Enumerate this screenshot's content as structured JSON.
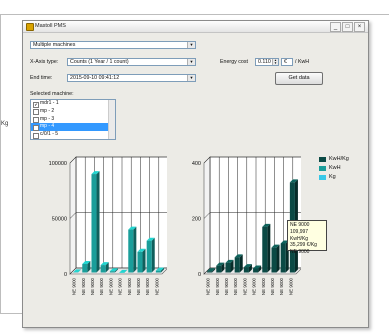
{
  "window": {
    "title": "Mastoll PMS",
    "controls": [
      "_",
      "□",
      "×"
    ]
  },
  "form": {
    "machine_select": "Multiple machines",
    "x_axis_label": "X-Axis type:",
    "x_axis_value": "Counts (1 Year / 1 count)",
    "end_time_label": "End time:",
    "end_time_value": "2015-09-10 09:41:12",
    "energy_cost_label": "Energy cost",
    "energy_cost_value": "0.110",
    "energy_cost_currency": "€",
    "energy_unit": "/ KwH",
    "get_data_button": "Get data",
    "selected_machine_label": "Selected machine:"
  },
  "machines": [
    {
      "label": "mdr1 - 1",
      "checked": true,
      "selected": false
    },
    {
      "label": "mp - 2",
      "checked": false,
      "selected": false
    },
    {
      "label": "mp - 3",
      "checked": false,
      "selected": false
    },
    {
      "label": "mp - 4",
      "checked": false,
      "selected": true
    },
    {
      "label": "c/0/1 - 5",
      "checked": false,
      "selected": false
    }
  ],
  "legend": [
    {
      "name": "KwH/Kg",
      "color": "#0b4a45"
    },
    {
      "name": "KwH",
      "color": "#1a9e9a"
    },
    {
      "name": "Kg",
      "color": "#38c8e8"
    }
  ],
  "tooltip": {
    "line1": "NE 9000",
    "line2": "109,997 KwH/Kg",
    "line3": "35,299 €/Kg",
    "line4": "NE 9000"
  },
  "colors": {
    "series_dark": "#0b4a45",
    "series_mid": "#1a9e9a",
    "series_light": "#38c8e8",
    "selection": "#3399ff"
  },
  "chart_data": [
    {
      "type": "bar",
      "title": "",
      "categories": [
        "NE 9000",
        "NE 9000",
        "NE 9000",
        "NE 9000",
        "NE 9000",
        "NE 9000",
        "NE 9000",
        "NE 9000",
        "NE 9000",
        "NE 9000"
      ],
      "series": [
        {
          "name": "KwH",
          "values": [
            1500,
            9000,
            90000,
            8000,
            2500,
            1000,
            40000,
            20000,
            30000,
            3000
          ]
        }
      ],
      "ylim": [
        0,
        100000
      ],
      "yticks": [
        "0",
        "50000",
        "100000"
      ],
      "grid": true
    },
    {
      "type": "bar",
      "title": "",
      "categories": [
        "NE 9000",
        "NE 9000",
        "NE 9000",
        "NE 9000",
        "NE 9000",
        "NE 9000",
        "NE 9000",
        "NE 9000",
        "NE 9000",
        "NE 9000"
      ],
      "series": [
        {
          "name": "KwH/Kg",
          "values": [
            10,
            30,
            40,
            60,
            25,
            20,
            170,
            95,
            110,
            330
          ]
        }
      ],
      "ylim": [
        0,
        400
      ],
      "yticks": [
        "0",
        "200",
        "400"
      ],
      "grid": true
    }
  ],
  "background": {
    "left_fragment_text": "Kg"
  }
}
